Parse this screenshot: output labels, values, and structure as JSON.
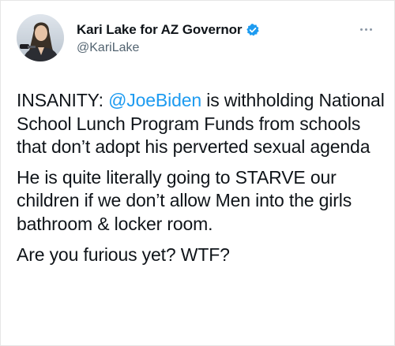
{
  "author": {
    "display_name": "Kari Lake for AZ Governor",
    "handle": "@KariLake",
    "verified": true,
    "avatar": "profile-photo"
  },
  "menu_icon": "more-options-icon",
  "colors": {
    "text": "#0f1419",
    "secondary": "#536471",
    "link": "#1d9bf0",
    "verified": "#1d9bf0"
  },
  "tweet": {
    "p1_prefix": "INSANITY: ",
    "p1_mention": "@JoeBiden",
    "p1_suffix": " is withholding National School Lunch Program Funds from schools that don’t adopt his perverted sexual agenda",
    "p2": "He is quite literally going to STARVE our children if we don’t allow Men into the girls bathroom & locker room.",
    "p3": "Are you furious yet? WTF?"
  }
}
